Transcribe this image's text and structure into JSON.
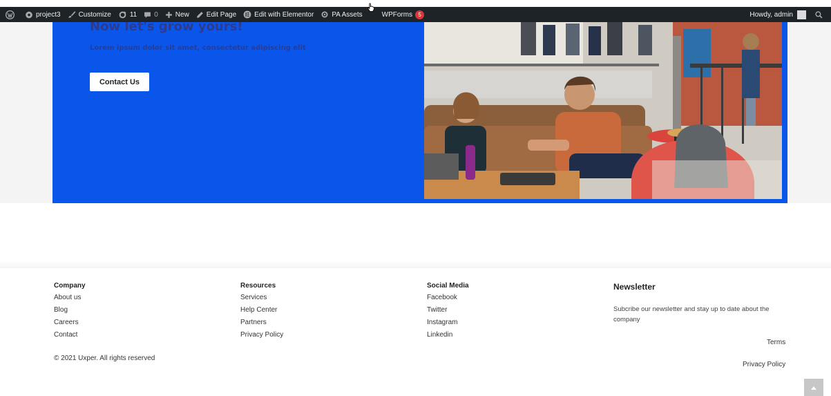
{
  "adminbar": {
    "site_name": "project3",
    "customize": "Customize",
    "updates_count": "11",
    "comments_count": "0",
    "new_label": "New",
    "edit_page": "Edit Page",
    "edit_elementor": "Edit with Elementor",
    "pa_assets": "PA Assets",
    "wpforms": "WPForms",
    "wpforms_badge": "5",
    "howdy": "Howdy, admin"
  },
  "hero": {
    "title": "Now let's grow yours!",
    "subtitle": "Lorem ipsum dolor sit amet, consectetur adipiscing elit",
    "button_label": "Contact Us",
    "bg_color": "#0b56ea"
  },
  "footer": {
    "company": {
      "heading": "Company",
      "links": [
        "About us",
        "Blog",
        "Careers",
        "Contact"
      ]
    },
    "resources": {
      "heading": "Resources",
      "links": [
        "Services",
        "Help Center",
        "Partners",
        "Privacy Policy"
      ]
    },
    "social": {
      "heading": "Social Media",
      "links": [
        "Facebook",
        "Twitter",
        "Instagram",
        "Linkedin"
      ]
    },
    "newsletter": {
      "heading": "Newsletter",
      "text": "Subcribe our newsletter and stay up to date about the company"
    },
    "copyright": "© 2021 Uxper. All rights reserved",
    "terms": "Terms",
    "privacy": "Privacy Policy"
  }
}
